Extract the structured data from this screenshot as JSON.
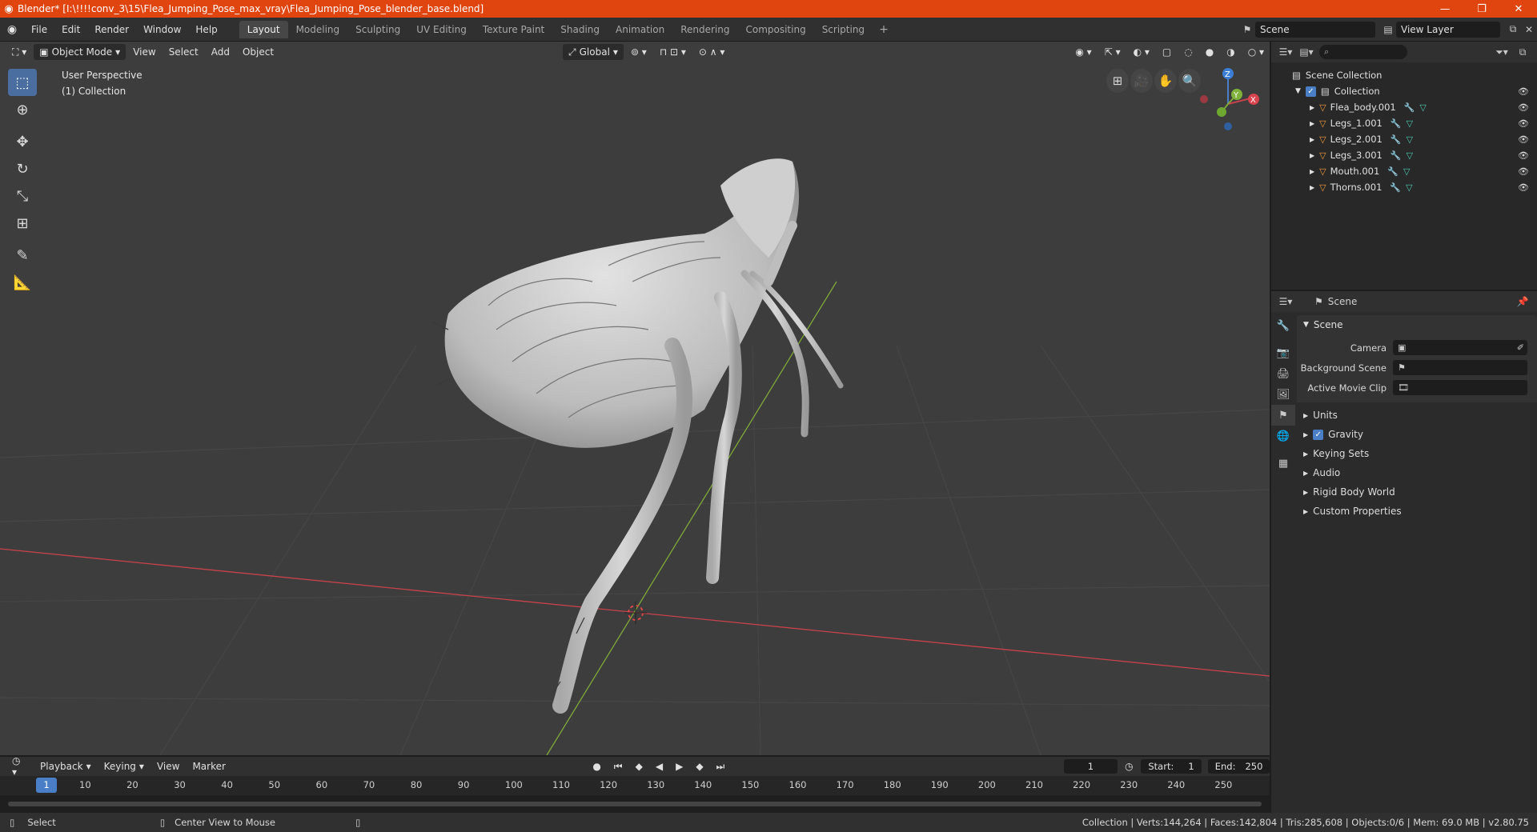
{
  "window": {
    "title": "Blender* [I:\\!!!!conv_3\\15\\Flea_Jumping_Pose_max_vray\\Flea_Jumping_Pose_blender_base.blend]",
    "minimize": "—",
    "restore": "❐",
    "close": "✕"
  },
  "menu": [
    "File",
    "Edit",
    "Render",
    "Window",
    "Help"
  ],
  "workspaces": [
    "Layout",
    "Modeling",
    "Sculpting",
    "UV Editing",
    "Texture Paint",
    "Shading",
    "Animation",
    "Rendering",
    "Compositing",
    "Scripting"
  ],
  "workspace_add": "+",
  "scene_name": "Scene",
  "view_layer": "View Layer",
  "viewport": {
    "mode": "Object Mode",
    "menus": [
      "View",
      "Select",
      "Add",
      "Object"
    ],
    "orientation": "Global",
    "perspective": "User Perspective",
    "collection": "(1) Collection"
  },
  "gizmo": {
    "z": "Z",
    "y": "Y",
    "x": "X"
  },
  "outliner": {
    "root": "Scene Collection",
    "collection": "Collection",
    "objects": [
      "Flea_body.001",
      "Legs_1.001",
      "Legs_2.001",
      "Legs_3.001",
      "Mouth.001",
      "Thorns.001"
    ]
  },
  "properties": {
    "context": "Scene",
    "panel": "Scene",
    "rows": [
      {
        "label": "Camera"
      },
      {
        "label": "Background Scene"
      },
      {
        "label": "Active Movie Clip"
      }
    ],
    "subpanels": [
      "Units",
      "Gravity",
      "Keying Sets",
      "Audio",
      "Rigid Body World",
      "Custom Properties"
    ]
  },
  "timeline": {
    "menus": [
      "Playback",
      "Keying",
      "View",
      "Marker"
    ],
    "current_frame": "1",
    "start_label": "Start:",
    "start": "1",
    "end_label": "End:",
    "end": "250",
    "ticks": [
      "10",
      "20",
      "30",
      "40",
      "50",
      "60",
      "70",
      "80",
      "90",
      "100",
      "110",
      "120",
      "130",
      "140",
      "150",
      "160",
      "170",
      "180",
      "190",
      "200",
      "210",
      "220",
      "230",
      "240",
      "250"
    ],
    "cursor_label": "1"
  },
  "status": {
    "select": "Select",
    "center": "Center View to Mouse",
    "stats": "Collection | Verts:144,264 | Faces:142,804 | Tris:285,608 | Objects:0/6 | Mem: 69.0 MB | v2.80.75"
  },
  "colors": {
    "accent": "#4a7fc8",
    "titlebar": "#e0450f",
    "x_axis": "#c8424c",
    "y_axis": "#7fa83a"
  }
}
